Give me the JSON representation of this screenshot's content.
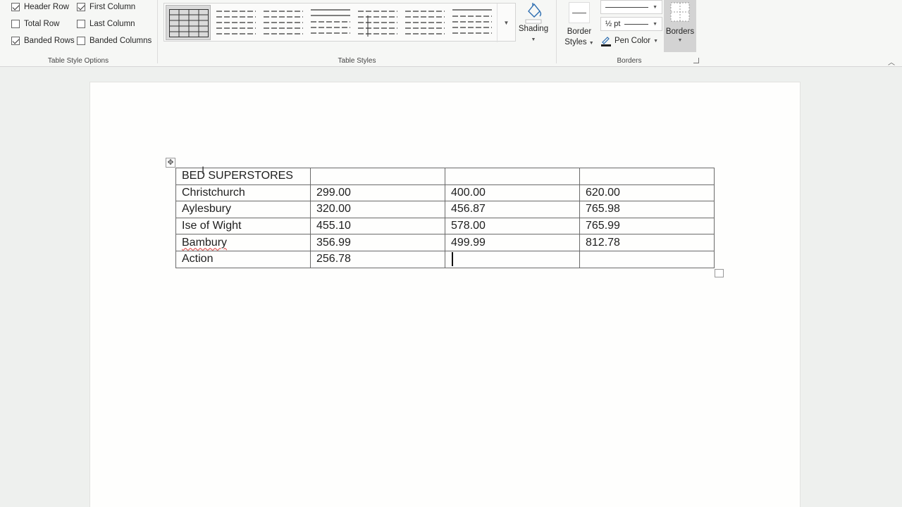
{
  "ribbon": {
    "table_style_options": {
      "label": "Table Style Options",
      "options": [
        {
          "label": "Header Row",
          "checked": true
        },
        {
          "label": "First Column",
          "checked": true
        },
        {
          "label": "Total Row",
          "checked": false
        },
        {
          "label": "Last Column",
          "checked": false
        },
        {
          "label": "Banded Rows",
          "checked": true
        },
        {
          "label": "Banded Columns",
          "checked": false
        }
      ]
    },
    "table_styles": {
      "label": "Table Styles",
      "shading_label": "Shading"
    },
    "borders": {
      "label": "Borders",
      "border_styles_line1": "Border",
      "border_styles_line2": "Styles",
      "pen_weight": "½ pt",
      "pen_color_label": "Pen Color",
      "borders_label": "Borders",
      "pen_color": "#1f1f1f"
    }
  },
  "document": {
    "rows": [
      [
        "BED SUPERSTORES",
        "",
        "",
        ""
      ],
      [
        "Christchurch",
        "299.00",
        "400.00",
        "620.00"
      ],
      [
        "Aylesbury",
        "320.00",
        "456.87",
        "765.98"
      ],
      [
        "Ise of Wight",
        "455.10",
        "578.00",
        "765.99"
      ],
      [
        "Bambury",
        "356.99",
        "499.99",
        "812.78"
      ],
      [
        "Action",
        "256.78",
        "",
        ""
      ]
    ]
  },
  "colors": {
    "ribbon_bg": "#f6f7f5",
    "canvas_bg": "#eef0ee",
    "accent_blue": "#2b6cb0"
  }
}
